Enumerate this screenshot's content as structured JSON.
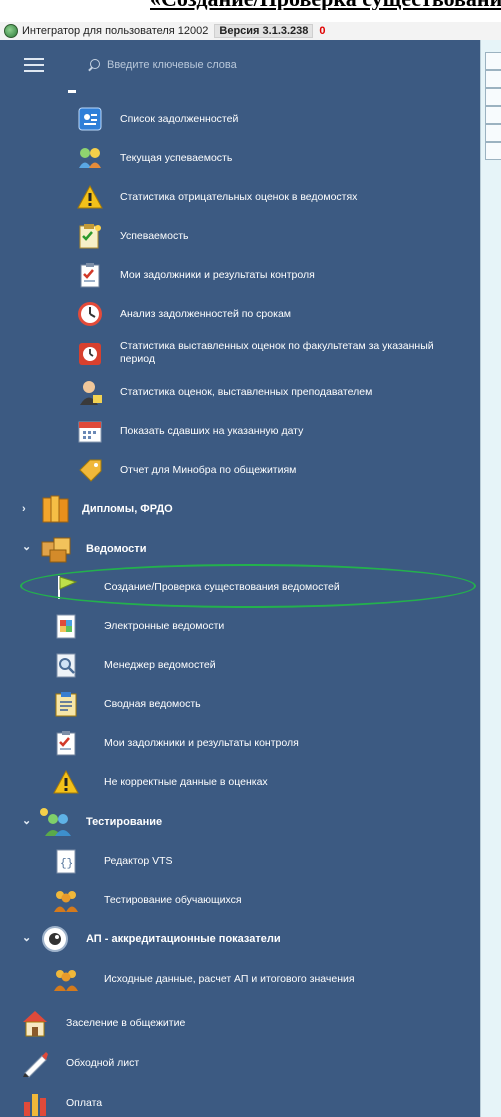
{
  "doc_heading_crop": "«Создание/Проверка существования ведомостей»",
  "titlebar": {
    "title": "Интегратор для пользователя 12002",
    "version": "Версия 3.1.3.238",
    "badge": "0"
  },
  "search": {
    "placeholder": "Введите ключевые слова"
  },
  "menu": {
    "reports": [
      {
        "label": "Список задолженностей",
        "icon": "debt-list-icon"
      },
      {
        "label": "Текущая успеваемость",
        "icon": "progress-people-icon"
      },
      {
        "label": "Статистика отрицательных оценок в ведомостях",
        "icon": "warning-icon"
      },
      {
        "label": "Успеваемость",
        "icon": "checklist-icon"
      },
      {
        "label": "Мои задолжники и результаты контроля",
        "icon": "clipboard-check-icon"
      },
      {
        "label": "Анализ задолженностей по срокам",
        "icon": "clock-icon"
      },
      {
        "label": "Статистика выставленных оценок по факультетам за указанный период",
        "icon": "alarm-clock-icon"
      },
      {
        "label": "Статистика оценок, выставленных преподавателем",
        "icon": "teacher-icon"
      },
      {
        "label": "Показать сдавших на указанную дату",
        "icon": "calendar-icon"
      },
      {
        "label": "Отчет для Минобра по общежитиям",
        "icon": "tag-icon"
      }
    ],
    "diplomas": {
      "label": "Дипломы, ФРДО",
      "icon": "books-icon"
    },
    "vedomosti": {
      "label": "Ведомости",
      "icon": "boxes-icon",
      "items": [
        {
          "label": "Создание/Проверка существования ведомостей",
          "icon": "flag-icon"
        },
        {
          "label": "Электронные ведомости",
          "icon": "e-document-icon"
        },
        {
          "label": "Менеджер ведомостей",
          "icon": "document-search-icon"
        },
        {
          "label": "Сводная ведомость",
          "icon": "clipboard-icon"
        },
        {
          "label": "Мои задолжники и результаты контроля",
          "icon": "clipboard-check-icon"
        },
        {
          "label": "Не корректные данные в оценках",
          "icon": "warning-icon"
        }
      ]
    },
    "testing": {
      "label": "Тестирование",
      "icon": "users-icon",
      "items": [
        {
          "label": "Редактор VTS",
          "icon": "code-editor-icon"
        },
        {
          "label": "Тестирование обучающихся",
          "icon": "group-icon"
        }
      ]
    },
    "ap": {
      "label": "АП - аккредитационные показатели",
      "icon": "eye-icon",
      "items": [
        {
          "label": "Исходные данные, расчет АП и итогового значения",
          "icon": "group-icon"
        }
      ]
    },
    "bottom": [
      {
        "label": "Заселение в общежитие",
        "icon": "house-icon"
      },
      {
        "label": "Обходной лист",
        "icon": "pencil-icon"
      },
      {
        "label": "Оплата",
        "icon": "bar-chart-icon"
      }
    ]
  },
  "colors": {
    "sidebar_bg": "#3c5a82",
    "highlight_ring": "#23b14d",
    "badge": "#e00000"
  }
}
